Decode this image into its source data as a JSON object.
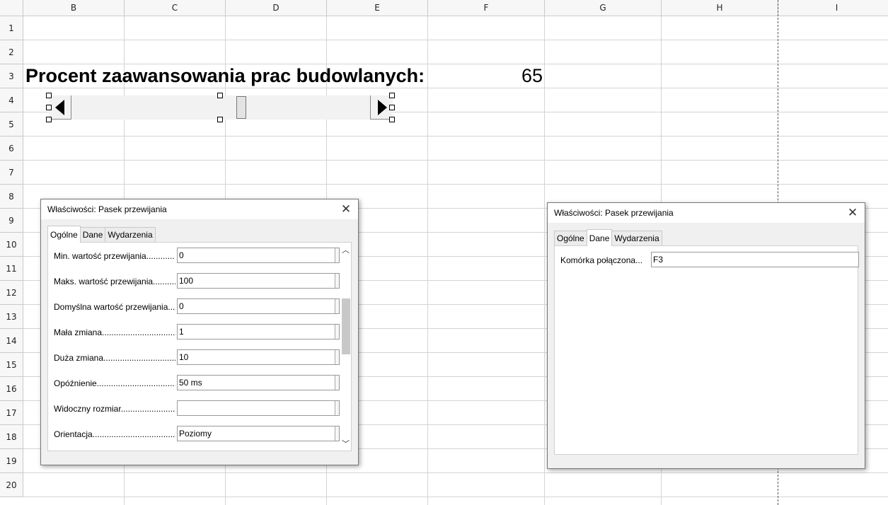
{
  "sheet": {
    "columns": [
      "B",
      "C",
      "D",
      "E",
      "F",
      "G",
      "H",
      "I"
    ],
    "rows": [
      "1",
      "2",
      "3",
      "4",
      "5",
      "6",
      "7",
      "8",
      "9",
      "10",
      "11",
      "12",
      "13",
      "14",
      "15",
      "16",
      "17",
      "18",
      "19",
      "20"
    ],
    "title_text": "Procent zaawansowania prac budowlanych:",
    "linked_value": "65",
    "scrollbar": {
      "min": 0,
      "max": 100,
      "value": 65
    }
  },
  "dialog_general": {
    "title": "Właściwości: Pasek przewijania",
    "close_icon": "close-icon",
    "tabs": [
      "Ogólne",
      "Dane",
      "Wydarzenia"
    ],
    "active_tab": "Ogólne",
    "rows": [
      {
        "label": "Min. wartość przewijania............",
        "value": "0"
      },
      {
        "label": "Maks. wartość przewijania..........",
        "value": "100"
      },
      {
        "label": "Domyślna wartość przewijania...",
        "value": "0"
      },
      {
        "label": "Mała zmiana.................................",
        "value": "1"
      },
      {
        "label": "Duża zmiana.................................",
        "value": "10"
      },
      {
        "label": "Opóźnienie...................................",
        "value": "50 ms"
      },
      {
        "label": "Widoczny rozmiar.........................",
        "value": ""
      },
      {
        "label": "Orientacja.....................................",
        "value": "Poziomy"
      }
    ]
  },
  "dialog_data": {
    "title": "Właściwości: Pasek przewijania",
    "close_icon": "close-icon",
    "tabs": [
      "Ogólne",
      "Dane",
      "Wydarzenia"
    ],
    "active_tab": "Dane",
    "linked_cell_label": "Komórka połączona...",
    "linked_cell_value": "F3"
  }
}
